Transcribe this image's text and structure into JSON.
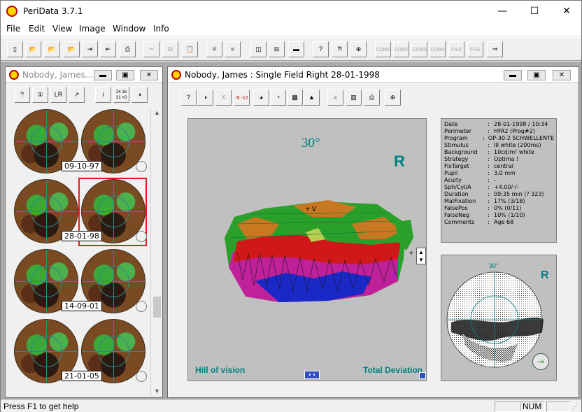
{
  "app": {
    "title": "PeriData 3.7.1",
    "window_buttons": {
      "minimize": "—",
      "maximize": "☐",
      "close": "✕"
    }
  },
  "menu": [
    "File",
    "Edit",
    "View",
    "Image",
    "Window",
    "Info"
  ],
  "toolbar": {
    "buttons": [
      {
        "icon": "new-document-icon",
        "glyph": "▯",
        "enabled": true
      },
      {
        "icon": "open-folder-icon",
        "glyph": "📂",
        "enabled": true
      },
      {
        "icon": "open-green-folder-icon",
        "glyph": "📂",
        "enabled": true
      },
      {
        "icon": "folder-disabled-icon",
        "glyph": "📂",
        "enabled": false
      },
      {
        "icon": "import-icon",
        "glyph": "⇥",
        "enabled": true
      },
      {
        "icon": "export-icon",
        "glyph": "⇤",
        "enabled": true
      },
      {
        "icon": "print-icon",
        "glyph": "⎙",
        "enabled": true
      },
      {
        "icon": "cut-icon",
        "glyph": "✂",
        "enabled": false
      },
      {
        "icon": "copy-icon",
        "glyph": "⧉",
        "enabled": false
      },
      {
        "icon": "paste-icon",
        "glyph": "📋",
        "enabled": false
      },
      {
        "icon": "bug-icon",
        "glyph": "✱",
        "enabled": false
      },
      {
        "icon": "stop-icon",
        "glyph": "■",
        "enabled": false
      },
      {
        "icon": "tile-vertical-icon",
        "glyph": "◫",
        "enabled": true
      },
      {
        "icon": "tile-horizontal-icon",
        "glyph": "⊟",
        "enabled": true
      },
      {
        "icon": "status-bar-icon",
        "glyph": "▬",
        "enabled": true
      },
      {
        "icon": "help-icon",
        "glyph": "?",
        "enabled": true
      },
      {
        "icon": "context-help-icon",
        "glyph": "⁈",
        "enabled": true
      },
      {
        "icon": "globe-icon",
        "glyph": "⊕",
        "enabled": true
      },
      {
        "icon": "com1-icon",
        "glyph": "COM1",
        "enabled": false
      },
      {
        "icon": "com2-icon",
        "glyph": "COM2",
        "enabled": false
      },
      {
        "icon": "com3-icon",
        "glyph": "COM3",
        "enabled": false
      },
      {
        "icon": "com4-icon",
        "glyph": "COM4",
        "enabled": false
      },
      {
        "icon": "file-icon",
        "glyph": "FILE",
        "enabled": false
      },
      {
        "icon": "file-2-icon",
        "glyph": "FILE",
        "enabled": false
      },
      {
        "icon": "key-exit-icon",
        "glyph": "⇒",
        "enabled": true
      }
    ]
  },
  "left_window": {
    "title": "Nobody, James...",
    "toolbar": [
      {
        "icon": "help-icon",
        "glyph": "?"
      },
      {
        "icon": "single-field-icon",
        "glyph": "①"
      },
      {
        "icon": "overview-icon",
        "glyph": "LR"
      },
      {
        "icon": "compare-icon",
        "glyph": "↗"
      },
      {
        "icon": "info-icon",
        "glyph": "i"
      },
      {
        "icon": "values-icon",
        "glyph": "24 16 31 <0"
      },
      {
        "icon": "grayscale-icon",
        "glyph": "◑"
      }
    ],
    "visits": [
      {
        "date": "09-10-97",
        "selected": false
      },
      {
        "date": "28-01-98",
        "selected": true
      },
      {
        "date": "14-09-01",
        "selected": false
      },
      {
        "date": "21-01-05",
        "selected": false
      }
    ],
    "scroll_position": 0.72
  },
  "main_window": {
    "title": "Nobody, James  :  Single Field  Right  28-01-1998",
    "toolbar": [
      {
        "icon": "help-icon",
        "glyph": "?"
      },
      {
        "icon": "grayscale-icon",
        "glyph": "◑"
      },
      {
        "icon": "dot-pattern-icon",
        "glyph": "⁙"
      },
      {
        "icon": "values-icon",
        "glyph": "-5 -12"
      },
      {
        "icon": "color-wheel-icon",
        "glyph": "◕"
      },
      {
        "icon": "color-pie-icon",
        "glyph": "◔"
      },
      {
        "icon": "grid-icon",
        "glyph": "▦"
      },
      {
        "icon": "hill-icon",
        "glyph": "▲"
      },
      {
        "icon": "magnifier-icon",
        "glyph": "⌕"
      },
      {
        "icon": "histogram-icon",
        "glyph": "▥"
      },
      {
        "icon": "print-icon",
        "glyph": "⎙"
      },
      {
        "icon": "crosshair-icon",
        "glyph": "⊕"
      }
    ],
    "plot": {
      "angle": "30°",
      "eye": "R",
      "left_caption": "Hill of vision",
      "right_caption": "Total Deviation",
      "cursor_label": "+ V"
    },
    "info": {
      "rows": [
        {
          "k": "Date",
          "v": "28-01-1998 / 10:34"
        },
        {
          "k": "Perimeter",
          "v": "HFA2 (Prog#2)"
        },
        {
          "k": "Program",
          "v": "OP-30-2 SCHWELLENTE"
        },
        {
          "k": "Stimulus",
          "v": "III  white (200ms)"
        },
        {
          "k": "Background",
          "v": "10cd/m² white"
        },
        {
          "k": "Strategy",
          "v": "Optima !"
        },
        {
          "k": "FixTarget",
          "v": "central"
        },
        {
          "k": "Pupil",
          "v": "3.0 mm"
        },
        {
          "k": "Acuity",
          "v": "-"
        },
        {
          "k": "Sph/Cyl/A",
          "v": "+4.00/-/-"
        },
        {
          "k": "Duration",
          "v": "09:35 min (? 323)"
        },
        {
          "k": "MalFixation",
          "v": "17% (3/18)"
        },
        {
          "k": "FalsePos",
          "v": "0% (0/11)"
        },
        {
          "k": "FalseNeg",
          "v": "10% (1/10)"
        },
        {
          "k": "Comments",
          "v": "Age 68"
        }
      ]
    },
    "grayscale": {
      "angle": "30°",
      "eye": "R"
    }
  },
  "statusbar": {
    "help": "Press F1 to get help",
    "num": "NUM"
  },
  "colors": {
    "teal": "#008080",
    "selection": "#e02020",
    "hill_green": "#2aa02a",
    "hill_magenta": "#c0209a",
    "hill_red": "#d01818",
    "hill_blue": "#1a28c8",
    "hill_orange": "#c87820"
  }
}
